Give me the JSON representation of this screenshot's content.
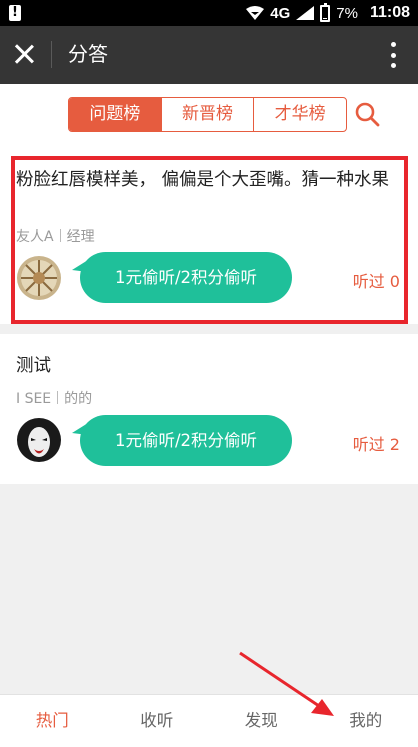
{
  "status_bar": {
    "network": "4G",
    "battery": "7%",
    "battery_level": 0.07,
    "time": "11:08"
  },
  "header": {
    "title": "分答"
  },
  "tabs": [
    {
      "label": "问题榜",
      "active": true
    },
    {
      "label": "新晋榜",
      "active": false
    },
    {
      "label": "才华榜",
      "active": false
    }
  ],
  "questions": [
    {
      "text": "粉脸红唇模样美， 偏偏是个大歪嘴。猜一种水果",
      "asker": "友人A",
      "role": "经理",
      "listen_label": "1元偷听/2积分偷听",
      "heard": "听过 0",
      "highlighted": true
    },
    {
      "text": "测试",
      "asker": "I SEE",
      "role": "的的",
      "listen_label": "1元偷听/2积分偷听",
      "heard": "听过 2",
      "highlighted": false
    }
  ],
  "bottom_nav": [
    {
      "label": "热门",
      "active": true
    },
    {
      "label": "收听",
      "active": false
    },
    {
      "label": "发现",
      "active": false
    },
    {
      "label": "我的",
      "active": false
    }
  ],
  "colors": {
    "accent": "#e65c3f",
    "bubble": "#1fc09a",
    "highlight": "#e8262d",
    "title_bar": "#353535"
  }
}
